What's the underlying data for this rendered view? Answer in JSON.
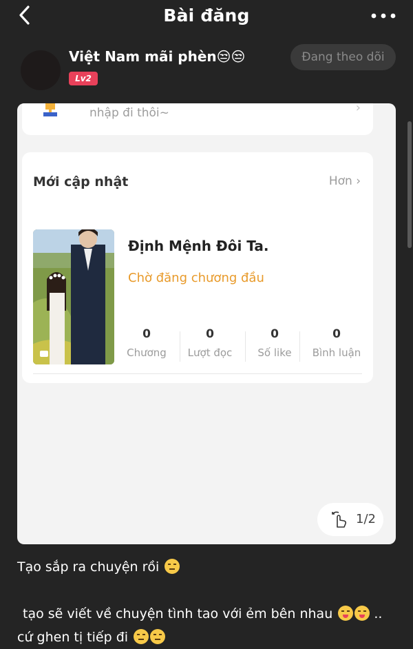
{
  "header": {
    "title": "Bài đăng",
    "back_icon": "chevron-left-icon",
    "more_icon": "more-horizontal-icon"
  },
  "author": {
    "name": "Việt Nam mãi phèn😒😒",
    "level": "Lv2",
    "follow_label": "Đang theo dõi"
  },
  "shared_image": {
    "top_card": {
      "text": "nhập đi thôi~",
      "icon": "trophy-icon"
    },
    "section": {
      "title": "Mới cập nhật",
      "more_label": "Hơn"
    },
    "book": {
      "title": "Định Mệnh Đôi Ta.",
      "status": "Chờ đăng chương đầu",
      "stats": [
        {
          "value": "0",
          "label": "Chương"
        },
        {
          "value": "0",
          "label": "Lượt đọc"
        },
        {
          "value": "0",
          "label": "Số like"
        },
        {
          "value": "0",
          "label": "Bình luận"
        }
      ]
    },
    "pager": {
      "text": "1/2"
    }
  },
  "post": {
    "line1": "Tạo sắp ra chuyện rồi",
    "line2": "tạo sẽ viết về chuyện tình tao với ẻm bên nhau",
    "line2_tail": "..",
    "line3": "cứ ghen tị tiếp đi"
  },
  "colors": {
    "background": "#242424",
    "accent_status": "#e89a2a",
    "level_badge": "#e8415a"
  }
}
